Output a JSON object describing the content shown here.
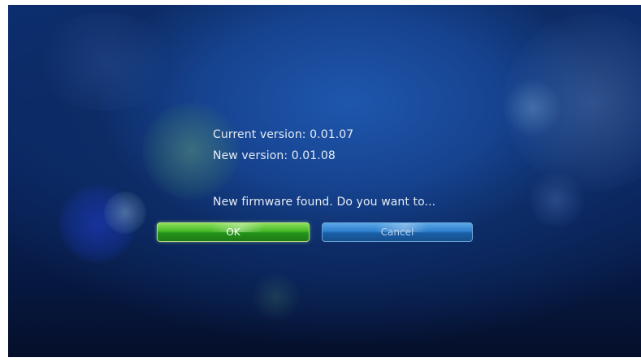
{
  "dialog": {
    "current_version_line": "Current version: 0.01.07",
    "new_version_line": "New version: 0.01.08",
    "prompt": "New firmware found. Do you want to..."
  },
  "buttons": {
    "ok_label": "OK",
    "cancel_label": "Cancel"
  },
  "colors": {
    "background": "#0a2560",
    "ok_button": "#45b827",
    "cancel_button": "#2d7fcc",
    "text": "#e6ecf5"
  }
}
